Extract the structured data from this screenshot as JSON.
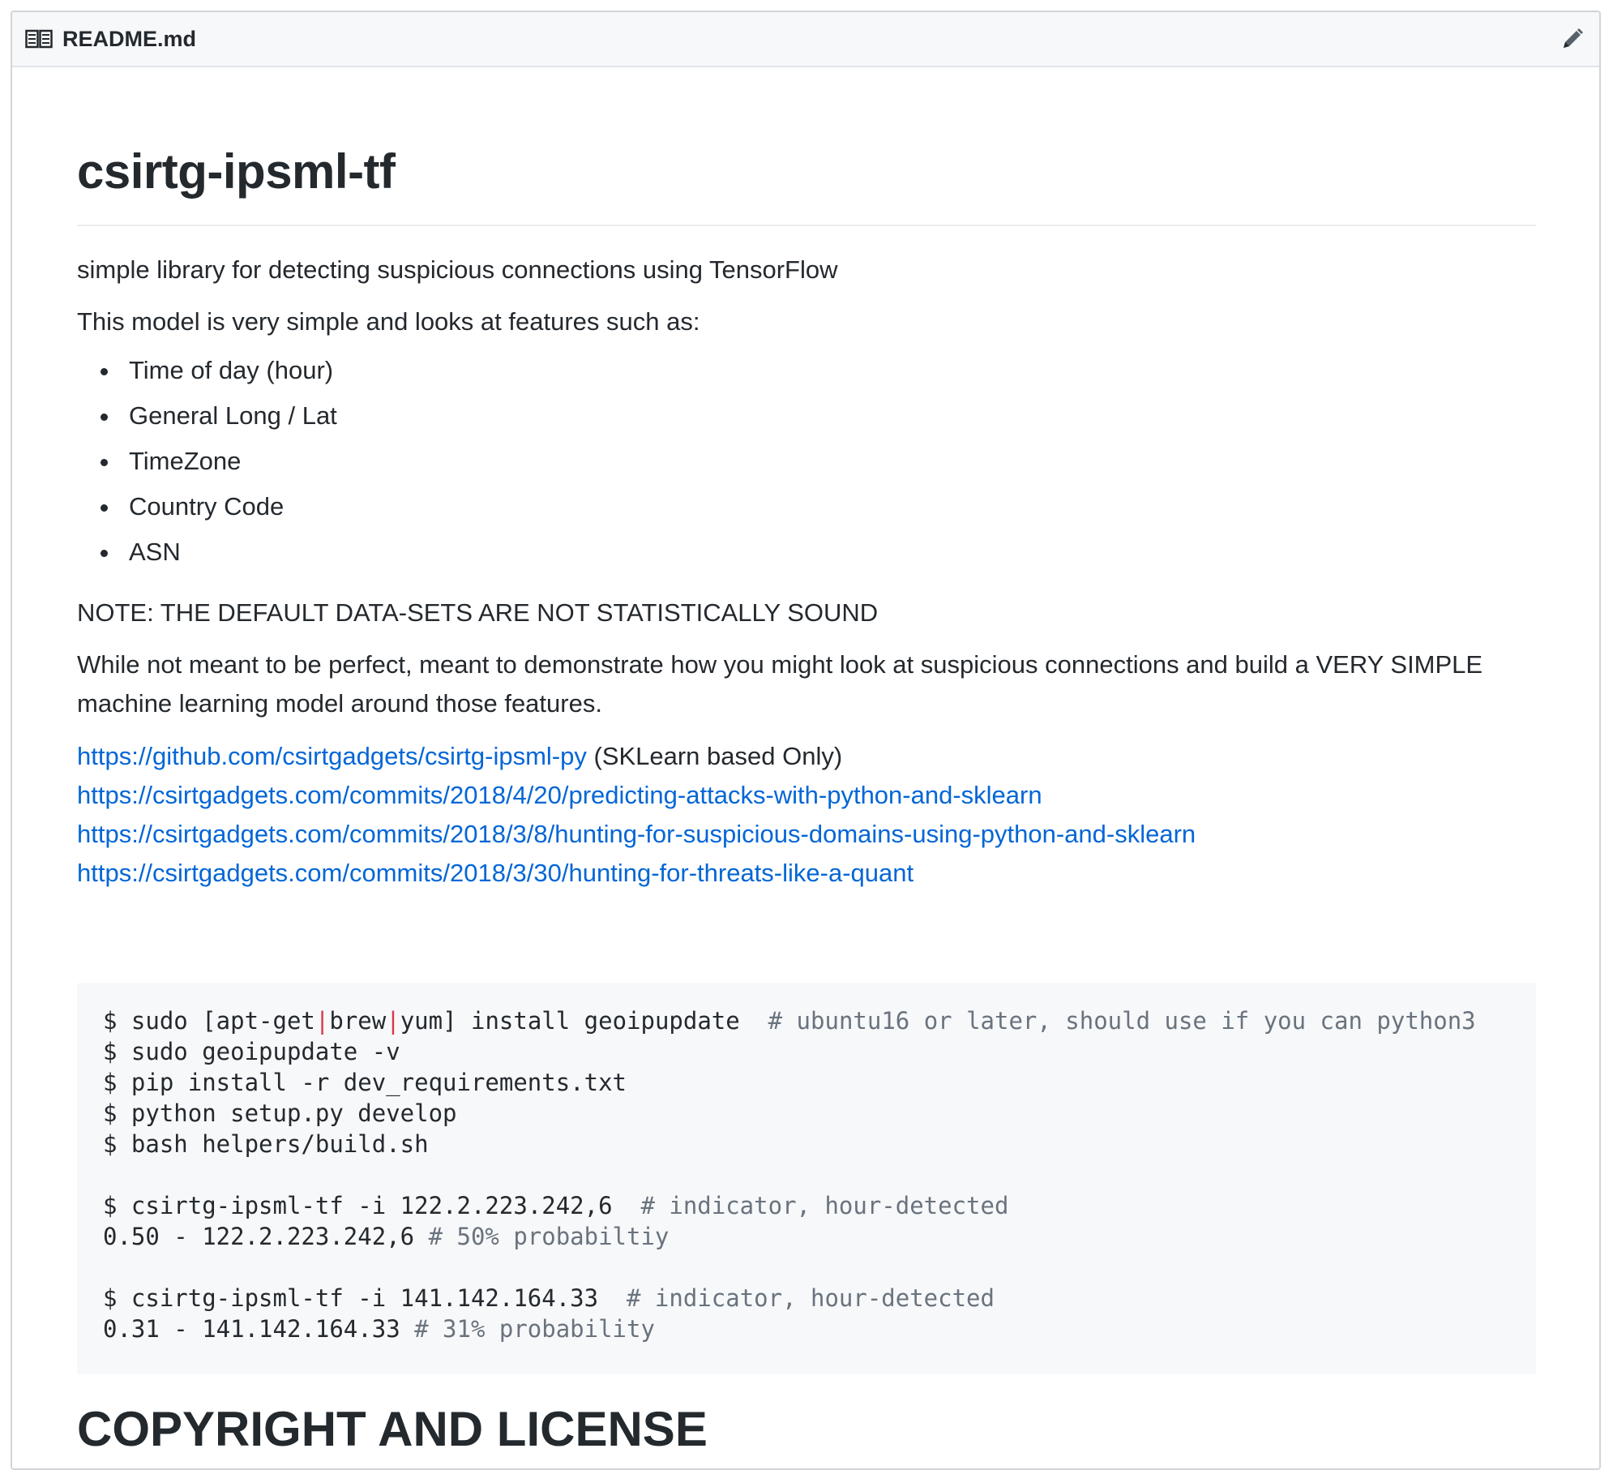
{
  "header": {
    "filename": "README.md",
    "book_icon": "book-icon",
    "edit_icon": "pencil-icon"
  },
  "readme": {
    "title": "csirtg-ipsml-tf",
    "description": "simple library for detecting suspicious connections using TensorFlow",
    "features_intro": "This model is very simple and looks at features such as:",
    "features": [
      "Time of day (hour)",
      "General Long / Lat",
      "TimeZone",
      "Country Code",
      "ASN"
    ],
    "note": "NOTE: THE DEFAULT DATA-SETS ARE NOT STATISTICALLY SOUND",
    "purpose": "While not meant to be perfect, meant to demonstrate how you might look at suspicious connections and build a VERY SIMPLE machine learning model around those features.",
    "links": [
      {
        "url": "https://github.com/csirtgadgets/csirtg-ipsml-py",
        "suffix": " (SKLearn based Only)"
      },
      {
        "url": "https://csirtgadgets.com/commits/2018/4/20/predicting-attacks-with-python-and-sklearn",
        "suffix": ""
      },
      {
        "url": "https://csirtgadgets.com/commits/2018/3/8/hunting-for-suspicious-domains-using-python-and-sklearn",
        "suffix": ""
      },
      {
        "url": "https://csirtgadgets.com/commits/2018/3/30/hunting-for-threats-like-a-quant",
        "suffix": ""
      }
    ],
    "code": {
      "l1_a": "$ sudo [apt-get",
      "l1_pipe1": "|",
      "l1_b": "brew",
      "l1_pipe2": "|",
      "l1_c": "yum] install geoipupdate  ",
      "l1_comment": "# ubuntu16 or later, should use if you can python3",
      "l2": "$ sudo geoipupdate -v",
      "l3": "$ pip install -r dev_requirements.txt",
      "l4": "$ python setup.py develop",
      "l5": "$ bash helpers/build.sh",
      "l7": "$ csirtg-ipsml-tf -i 122.2.223.242,6  ",
      "l7_comment": "# indicator, hour-detected",
      "l8": "0.50 - 122.2.223.242,6 ",
      "l8_comment": "# 50% probabiltiy",
      "l10": "$ csirtg-ipsml-tf -i 141.142.164.33  ",
      "l10_comment": "# indicator, hour-detected",
      "l11": "0.31 - 141.142.164.33 ",
      "l11_comment": "# 31% probability"
    },
    "next_heading": "COPYRIGHT AND LICENSE"
  }
}
